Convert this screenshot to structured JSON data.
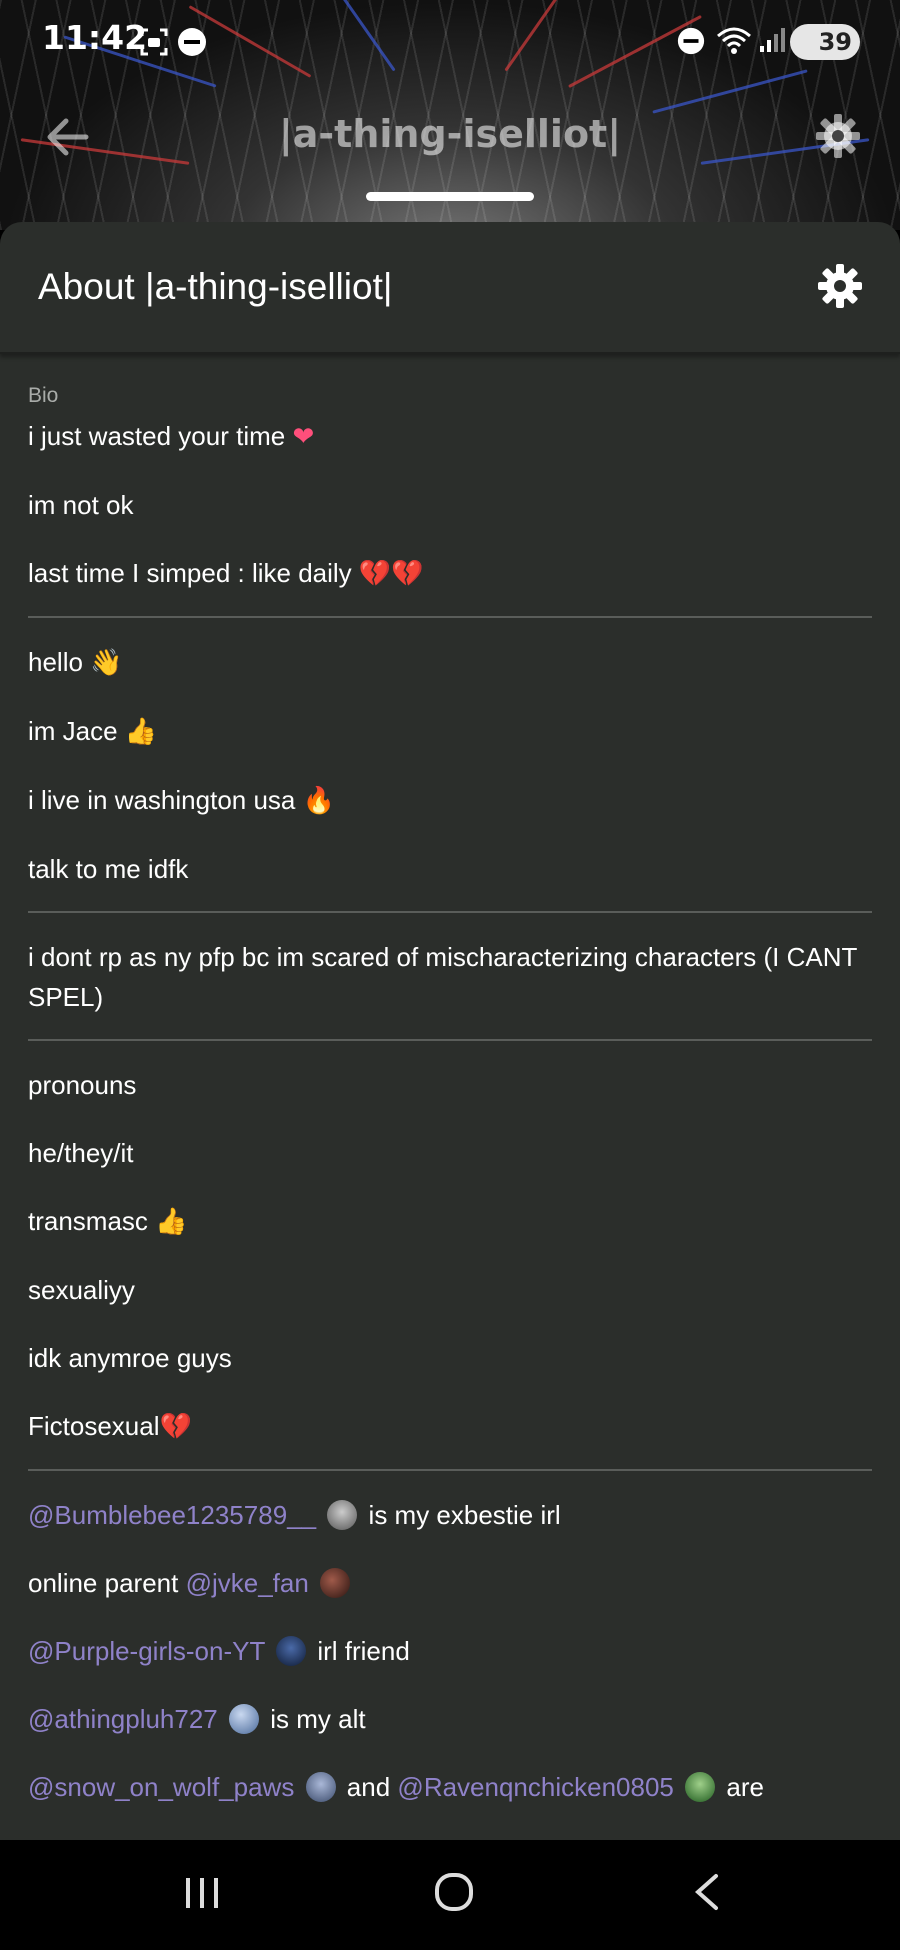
{
  "status": {
    "time": "11:42",
    "battery": "39"
  },
  "top_nav": {
    "title": "|a-thing-iselliot|"
  },
  "sheet": {
    "title": "About |a-thing-iselliot|"
  },
  "bio": {
    "label": "Bio",
    "section1": [
      {
        "text": "i just wasted your time ",
        "emoji": "❤"
      },
      {
        "text": "im not ok",
        "emoji": ""
      },
      {
        "text": "last time I simped : like daily ",
        "emoji": "💔💔"
      }
    ],
    "section2": [
      {
        "text": "hello ",
        "emoji": "👋"
      },
      {
        "text": "im Jace ",
        "emoji": "👍"
      },
      {
        "text": "i live in washington usa ",
        "emoji": "🔥"
      },
      {
        "text": "talk to me idfk",
        "emoji": ""
      }
    ],
    "section3": [
      {
        "text": "i dont rp as ny pfp bc im scared of mischaracterizing characters (I CANT SPEL)"
      }
    ],
    "section4": [
      {
        "text": "pronouns",
        "emoji": ""
      },
      {
        "text": "he/they/it",
        "emoji": ""
      },
      {
        "text": "transmasc ",
        "emoji": "👍"
      },
      {
        "text": "sexualiyy",
        "emoji": ""
      },
      {
        "text": "idk anymroe guys",
        "emoji": ""
      },
      {
        "text": "Fictosexual",
        "emoji": "💔"
      }
    ],
    "friends": {
      "f1_mention": "@Bumblebee1235789__",
      "f1_text": " is my exbestie irl",
      "f2_text": "online parent ",
      "f2_mention": "@jvke_fan",
      "f3_mention": "@Purple-girls-on-YT",
      "f3_text": " irl friend",
      "f4_mention": "@athingpluh727",
      "f4_text": " is my alt",
      "f5_mention_a": "@snow_on_wolf_paws",
      "f5_and": "and",
      "f5_mention_b": "@Ravenqnchicken0805",
      "f5_are": "are"
    }
  },
  "colors": {
    "sheet_bg": "#2b2e2b",
    "mention": "#8f82c9",
    "divider": "#5a5d5a"
  }
}
